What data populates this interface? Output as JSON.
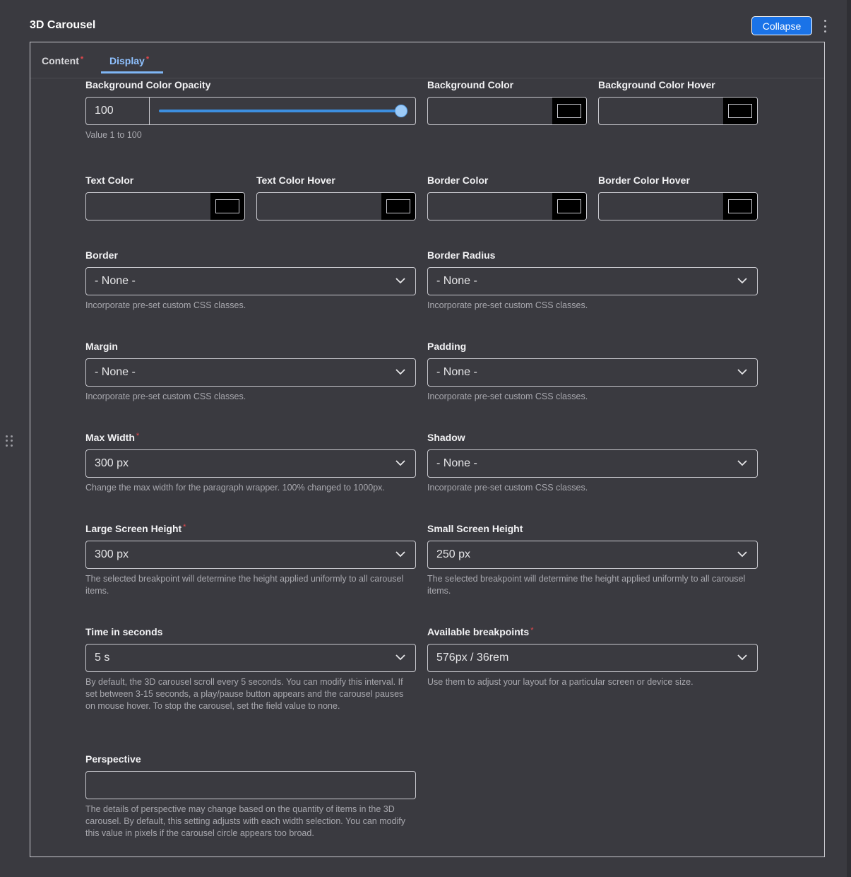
{
  "header": {
    "title": "3D Carousel",
    "collapse_label": "Collapse"
  },
  "tabs": [
    {
      "label": "Content",
      "required": "*"
    },
    {
      "label": "Display",
      "required": "*",
      "active": true
    }
  ],
  "opacity": {
    "label": "Background Color Opacity",
    "value": "100",
    "help": "Value 1 to 100",
    "slider_fraction": 1.0
  },
  "colors": {
    "swatch_color": "#000000",
    "background_color": "Background Color",
    "background_color_hover": "Background Color Hover",
    "text_color": "Text Color",
    "text_color_hover": "Text Color Hover",
    "border_color": "Border Color",
    "border_color_hover": "Border Color Hover"
  },
  "fields": {
    "border": {
      "label": "Border",
      "value": "- None -",
      "help": "Incorporate pre-set custom CSS classes."
    },
    "border_radius": {
      "label": "Border Radius",
      "value": "- None -",
      "help": "Incorporate pre-set custom CSS classes."
    },
    "margin": {
      "label": "Margin",
      "value": "- None -",
      "help": "Incorporate pre-set custom CSS classes."
    },
    "padding": {
      "label": "Padding",
      "value": "- None -",
      "help": "Incorporate pre-set custom CSS classes."
    },
    "max_width": {
      "label": "Max Width",
      "required": "*",
      "value": "300 px",
      "help": "Change the max width for the paragraph wrapper. 100% changed to 1000px."
    },
    "shadow": {
      "label": "Shadow",
      "value": "- None -",
      "help": "Incorporate pre-set custom CSS classes."
    },
    "large_screen_height": {
      "label": "Large Screen Height",
      "required": "*",
      "value": "300 px",
      "help": "The selected breakpoint will determine the height applied uniformly to all carousel items."
    },
    "small_screen_height": {
      "label": "Small Screen Height",
      "value": "250 px",
      "help": "The selected breakpoint will determine the height applied uniformly to all carousel items."
    },
    "time_in_seconds": {
      "label": "Time in seconds",
      "value": "5 s",
      "help": "By default, the 3D carousel scroll every 5 seconds. You can modify this interval. If set between 3-15 seconds, a play/pause button appears and the carousel pauses on mouse hover. To stop the carousel, set the field value to none."
    },
    "available_breakpoints": {
      "label": "Available breakpoints",
      "required": "*",
      "value": "576px / 36rem",
      "help": "Use them to adjust your layout for a particular screen or device size."
    },
    "perspective": {
      "label": "Perspective",
      "value": "",
      "help": "The details of perspective may change based on the quantity of items in the 3D carousel. By default, this setting adjusts with each width selection. You can modify this value in pixels if the carousel circle appears too broad."
    }
  }
}
